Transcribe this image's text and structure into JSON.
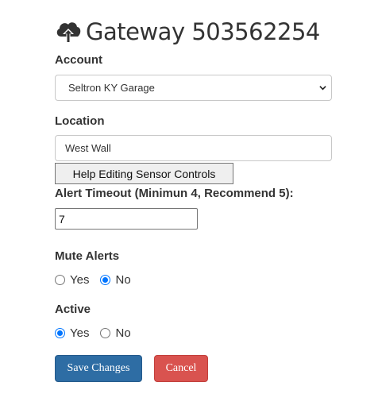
{
  "header": {
    "icon": "cloud-upload-icon",
    "title": "Gateway 503562254"
  },
  "account": {
    "label": "Account",
    "selected": "Seltron KY Garage"
  },
  "location": {
    "label": "Location",
    "value": "West Wall"
  },
  "help_button": {
    "label": "Help Editing Sensor Controls"
  },
  "alert_timeout": {
    "label": "Alert Timeout (Minimun 4, Recommend 5):",
    "value": "7"
  },
  "mute_alerts": {
    "label": "Mute Alerts",
    "options": [
      {
        "label": "Yes",
        "checked": false
      },
      {
        "label": "No",
        "checked": true
      }
    ]
  },
  "active": {
    "label": "Active",
    "options": [
      {
        "label": "Yes",
        "checked": true
      },
      {
        "label": "No",
        "checked": false
      }
    ]
  },
  "actions": {
    "save_label": "Save Changes",
    "cancel_label": "Cancel"
  },
  "colors": {
    "save_button": "#2e6da4",
    "cancel_button": "#d9534f",
    "radio_checked": "#0075ff"
  }
}
